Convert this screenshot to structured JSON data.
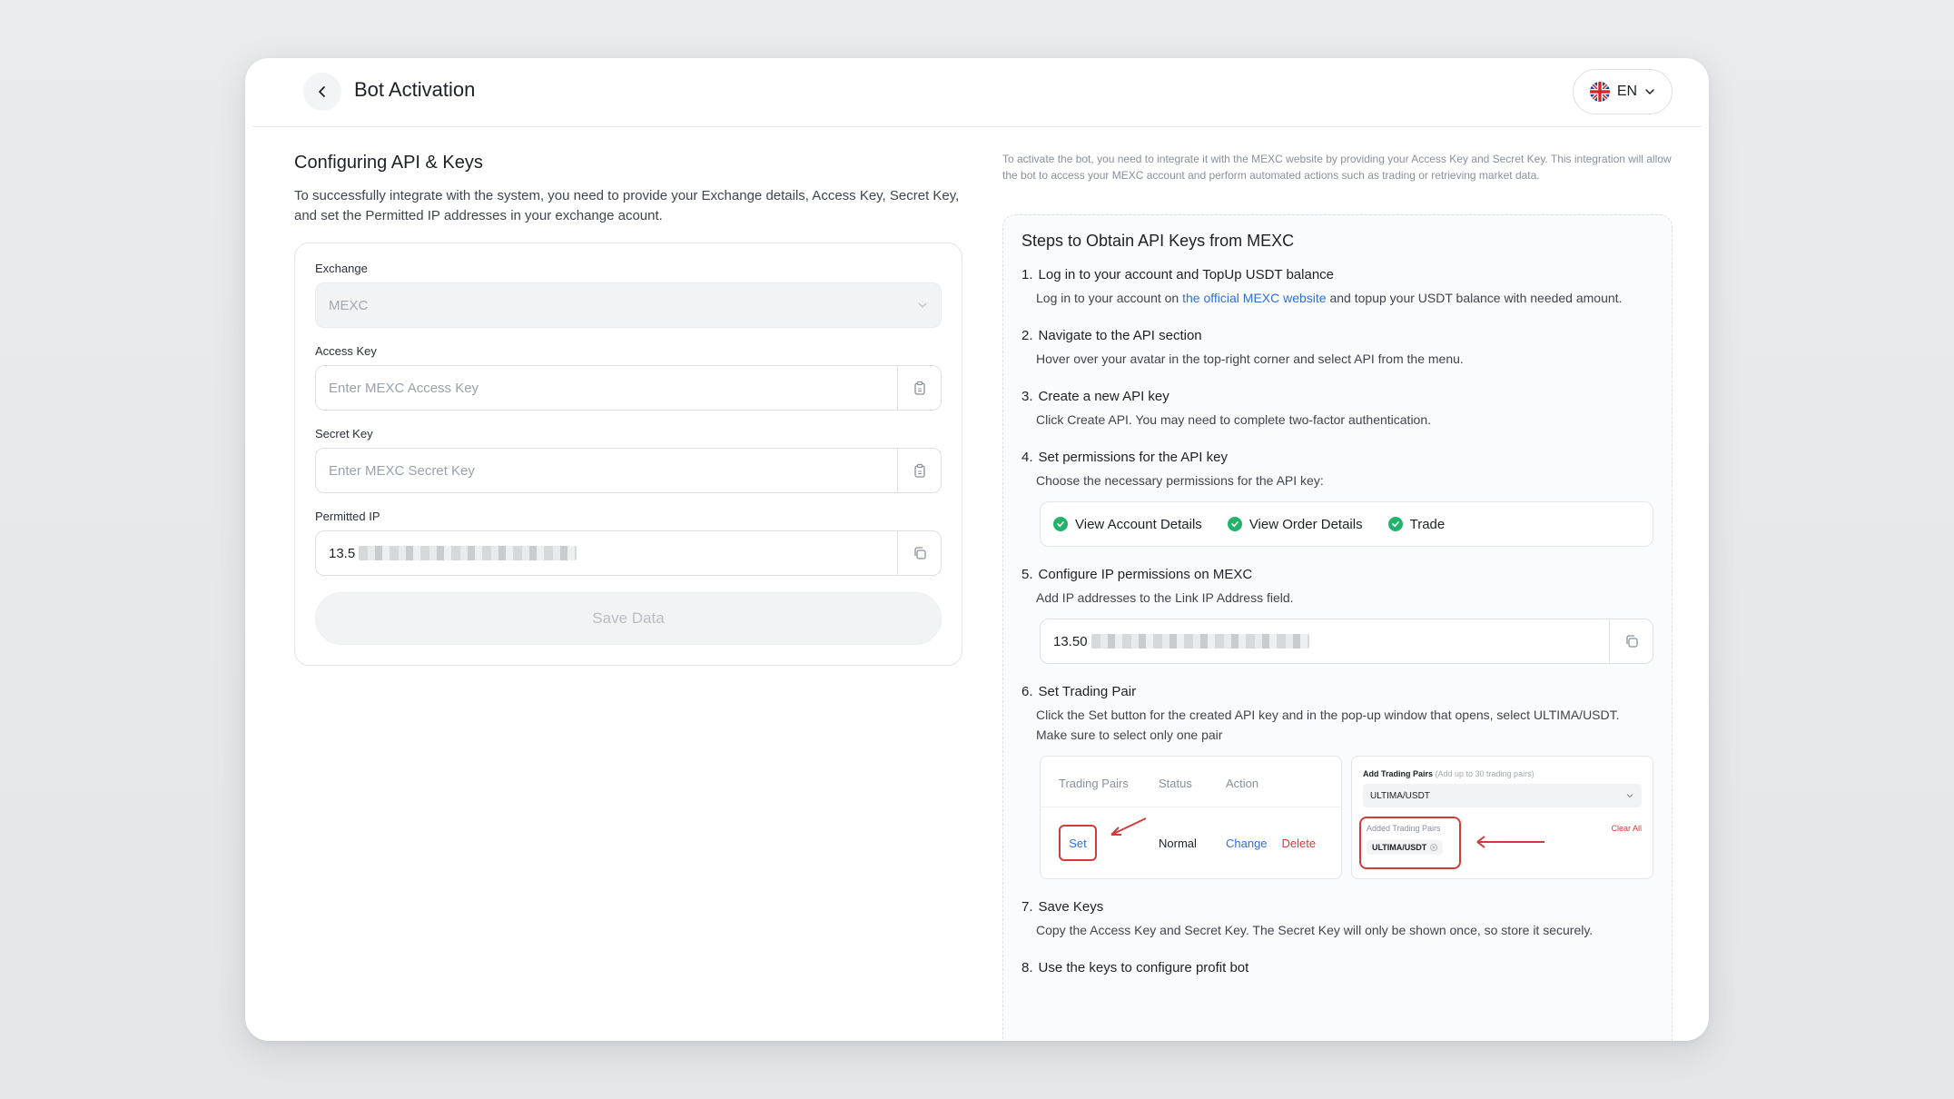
{
  "header": {
    "title": "Bot Activation",
    "language": "EN"
  },
  "left": {
    "title": "Configuring API & Keys",
    "description": "To successfully integrate with the system, you need to provide your Exchange details, Access Key, Secret Key, and set the Permitted IP addresses in your exchange acount.",
    "exchange": {
      "label": "Exchange",
      "value": "MEXC"
    },
    "access_key": {
      "label": "Access Key",
      "placeholder": "Enter MEXC Access Key"
    },
    "secret_key": {
      "label": "Secret Key",
      "placeholder": "Enter MEXC Secret Key"
    },
    "permitted_ip": {
      "label": "Permitted IP",
      "value_prefix": "13.5"
    },
    "save_label": "Save Data"
  },
  "right": {
    "intro": "To activate the bot, you need to integrate it with the MEXC website by providing your Access Key and Secret Key. This integration will allow the bot to access your MEXC account and perform automated actions such as trading or retrieving market data.",
    "steps_title": "Steps to Obtain API Keys from MEXC",
    "steps": [
      {
        "num": "1.",
        "title": "Log in to your account and TopUp USDT balance",
        "body_pre": "Log in to your account on ",
        "link": "the official MEXC website",
        "body_post": " and topup your USDT balance with needed amount."
      },
      {
        "num": "2.",
        "title": "Navigate to the API section",
        "body": "Hover over your avatar in the top-right corner and select API from the menu."
      },
      {
        "num": "3.",
        "title": "Create a new API key",
        "body": "Click Create API. You may need to complete two-factor authentication."
      },
      {
        "num": "4.",
        "title": "Set permissions for the API key",
        "body": "Choose the necessary permissions for the API key:"
      },
      {
        "num": "5.",
        "title": "Configure IP permissions on MEXC",
        "body": "Add IP addresses to the Link IP Address field."
      },
      {
        "num": "6.",
        "title": "Set Trading Pair",
        "body": "Click the Set button for the created API key and in the pop-up window that opens, select ULTIMA/USDT. Make sure to select only one pair"
      },
      {
        "num": "7.",
        "title": "Save Keys",
        "body": "Copy the Access Key and Secret Key. The Secret Key will only be shown once, so store it securely."
      },
      {
        "num": "8.",
        "title": "Use the keys to configure profit bot"
      }
    ],
    "permissions": [
      "View Account Details",
      "View Order Details",
      "Trade"
    ],
    "ip_prefix": "13.50",
    "pair_table": {
      "headers": [
        "Trading Pairs",
        "Status",
        "Action"
      ],
      "set": "Set",
      "status": "Normal",
      "change": "Change",
      "delete": "Delete"
    },
    "pair_modal": {
      "add_label": "Add Trading Pairs",
      "add_hint": "(Add up to 30 trading pairs)",
      "selected": "ULTIMA/USDT",
      "added_label": "Added Trading Pairs",
      "chip": "ULTIMA/USDT",
      "clear_all": "Clear All"
    }
  },
  "colors": {
    "accent_link": "#2f6fd6",
    "success": "#21b36b",
    "danger": "#d23b3b"
  },
  "icons": [
    "chevron-left-icon",
    "uk-flag-icon",
    "chevron-down-icon",
    "eye-closed-icon",
    "clipboard-icon",
    "copy-icon",
    "check-circle-icon",
    "arrow-icon"
  ]
}
